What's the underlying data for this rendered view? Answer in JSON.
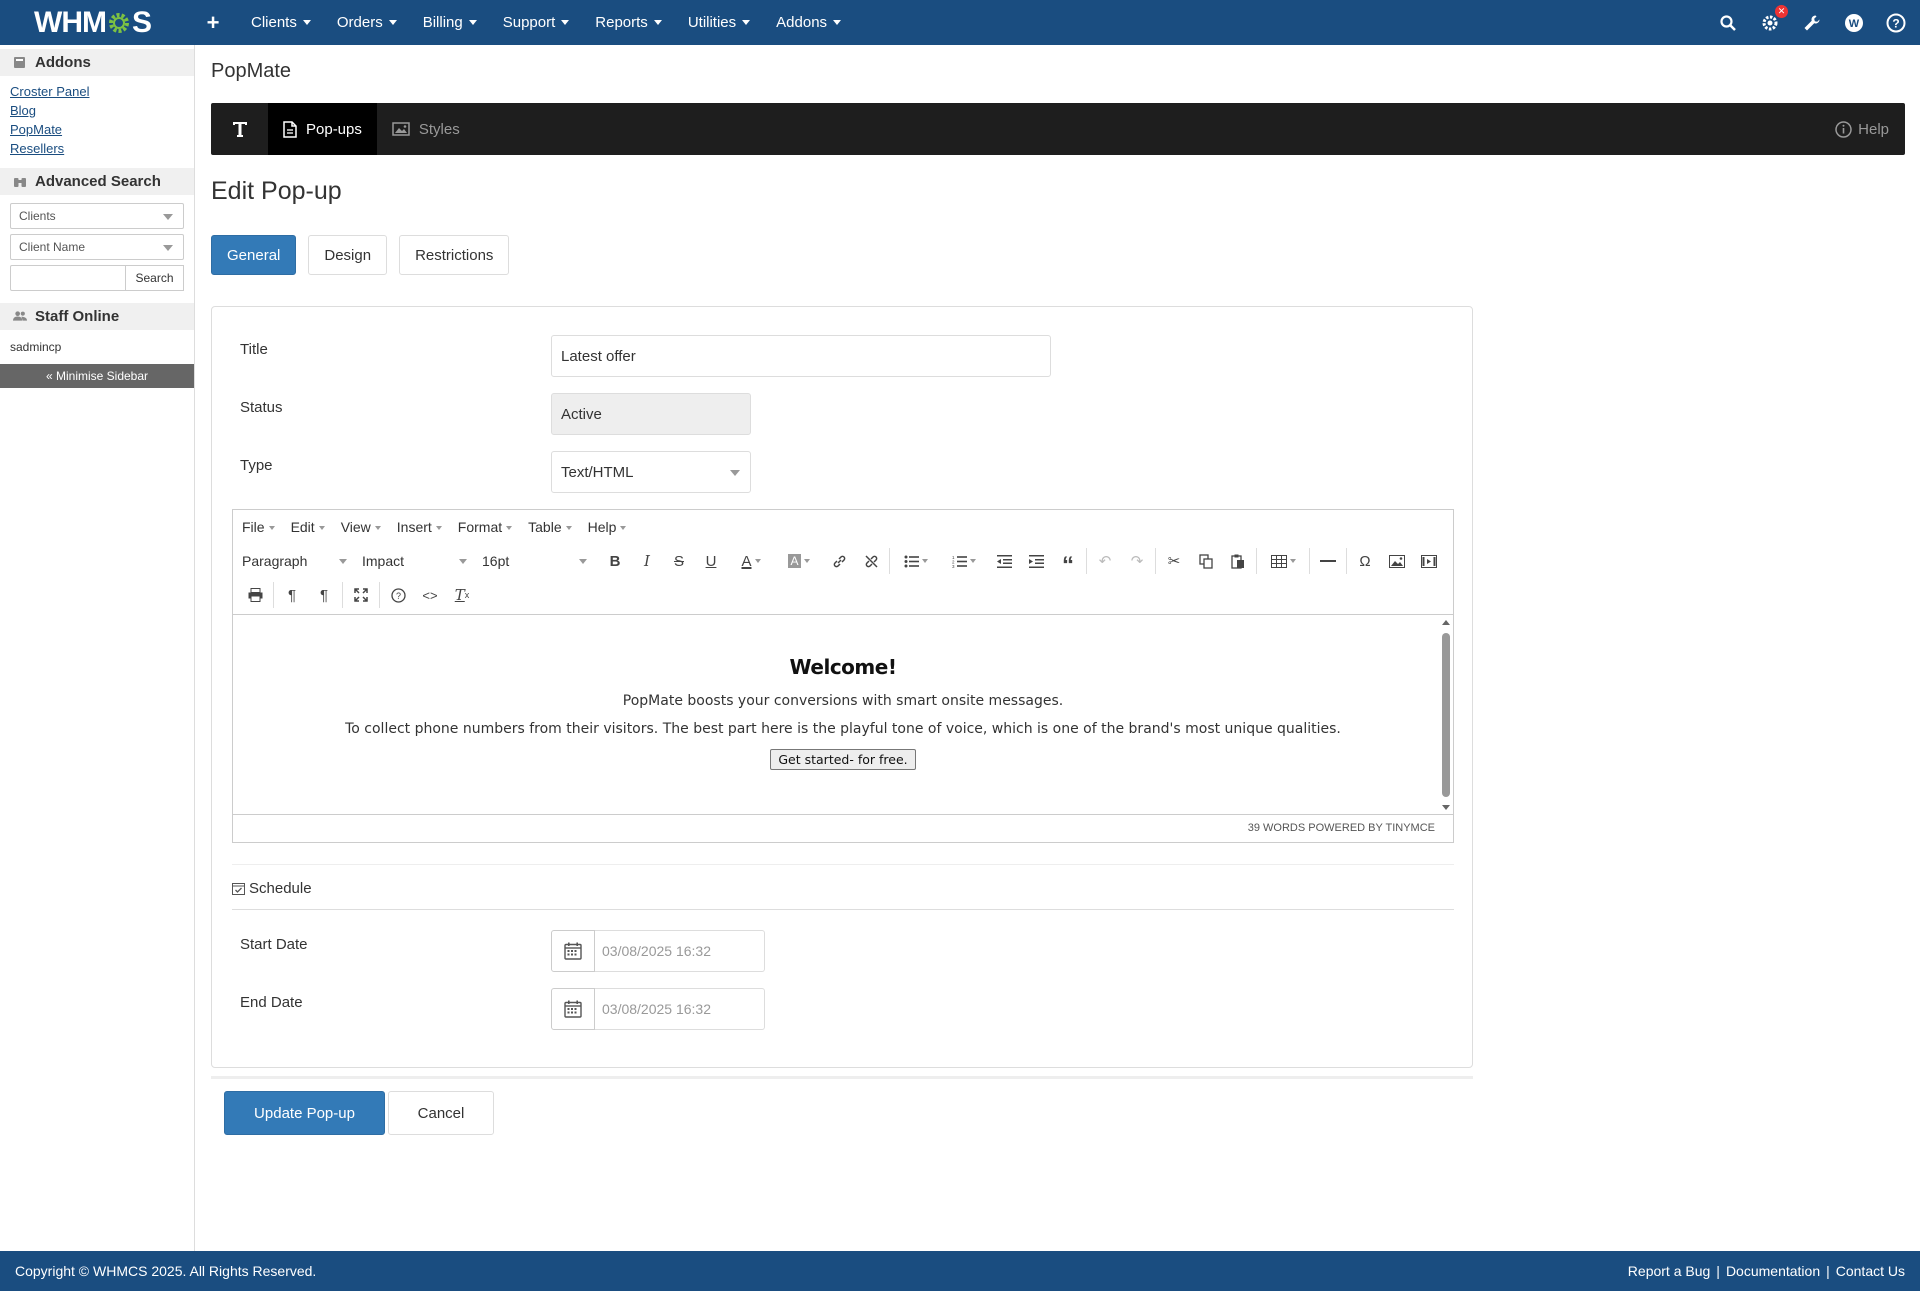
{
  "topnav": {
    "logo_prefix": "WHM",
    "logo_suffix": "S",
    "items": [
      "Clients",
      "Orders",
      "Billing",
      "Support",
      "Reports",
      "Utilities",
      "Addons"
    ]
  },
  "sidebar": {
    "addons_title": "Addons",
    "addon_links": [
      "Croster Panel",
      "Blog",
      "PopMate",
      "Resellers"
    ],
    "advanced_search_title": "Advanced Search",
    "search_type": "Clients",
    "search_field": "Client Name",
    "search_button": "Search",
    "staff_title": "Staff Online",
    "staff_user": "sadmincp",
    "minimise_label": "« Minimise Sidebar"
  },
  "main": {
    "page_title": "PopMate",
    "subnav": {
      "tab_popups": "Pop-ups",
      "tab_styles": "Styles",
      "help": "Help"
    },
    "section_title": "Edit Pop-up",
    "tabs": [
      "General",
      "Design",
      "Restrictions"
    ],
    "form": {
      "title_label": "Title",
      "title_value": "Latest offer",
      "status_label": "Status",
      "status_value": "Active",
      "type_label": "Type",
      "type_value": "Text/HTML"
    },
    "editor": {
      "menus": [
        "File",
        "Edit",
        "View",
        "Insert",
        "Format",
        "Table",
        "Help"
      ],
      "block_format": "Paragraph",
      "font_family": "Impact",
      "font_size": "16pt",
      "content_heading": "Welcome!",
      "content_line1": "PopMate boosts your conversions with smart onsite messages.",
      "content_line2": "To collect phone numbers from their visitors. The best part here is the playful tone of voice, which is one of the brand's most unique qualities.",
      "content_button": "Get started- for free.",
      "status_bar": "39 WORDS POWERED BY TINYMCE"
    },
    "schedule": {
      "title": "Schedule",
      "start_label": "Start Date",
      "start_value": "03/08/2025 16:32",
      "end_label": "End Date",
      "end_value": "03/08/2025 16:32"
    },
    "buttons": {
      "update": "Update Pop-up",
      "cancel": "Cancel"
    }
  },
  "footer": {
    "copyright": "Copyright © WHMCS 2025. All Rights Reserved.",
    "links": [
      "Report a Bug",
      "Documentation",
      "Contact Us"
    ]
  },
  "colors": {
    "brand": "#1a4d80",
    "primary_button": "#337ab7",
    "subnav_bg": "#1e1e1e"
  }
}
